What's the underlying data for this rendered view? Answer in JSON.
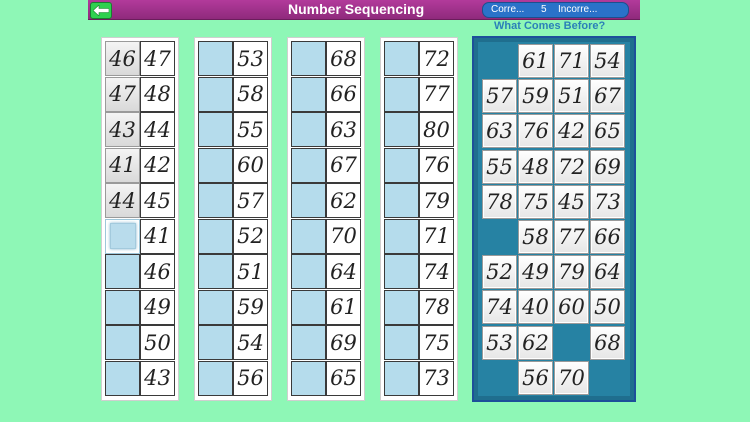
{
  "header": {
    "title": "Number Sequencing",
    "correct_label": "Corre...",
    "correct_count": "5",
    "incorrect_label": "Incorre...",
    "subtitle": "What Comes Before?",
    "back_icon": "back-arrow-icon"
  },
  "columns": [
    {
      "pairs": [
        [
          "46",
          "47"
        ],
        [
          "47",
          "48"
        ],
        [
          "43",
          "44"
        ],
        [
          "41",
          "42"
        ],
        [
          "44",
          "45"
        ],
        [
          "",
          "41"
        ],
        [
          "",
          "46"
        ],
        [
          "",
          "49"
        ],
        [
          "",
          "50"
        ],
        [
          "",
          "43"
        ]
      ],
      "selected_row": 5
    },
    {
      "pairs": [
        [
          "",
          "53"
        ],
        [
          "",
          "58"
        ],
        [
          "",
          "55"
        ],
        [
          "",
          "60"
        ],
        [
          "",
          "57"
        ],
        [
          "",
          "52"
        ],
        [
          "",
          "51"
        ],
        [
          "",
          "59"
        ],
        [
          "",
          "54"
        ],
        [
          "",
          "56"
        ]
      ],
      "selected_row": -1
    },
    {
      "pairs": [
        [
          "",
          "68"
        ],
        [
          "",
          "66"
        ],
        [
          "",
          "63"
        ],
        [
          "",
          "67"
        ],
        [
          "",
          "62"
        ],
        [
          "",
          "70"
        ],
        [
          "",
          "64"
        ],
        [
          "",
          "61"
        ],
        [
          "",
          "69"
        ],
        [
          "",
          "65"
        ]
      ],
      "selected_row": -1
    },
    {
      "pairs": [
        [
          "",
          "72"
        ],
        [
          "",
          "77"
        ],
        [
          "",
          "80"
        ],
        [
          "",
          "76"
        ],
        [
          "",
          "79"
        ],
        [
          "",
          "71"
        ],
        [
          "",
          "74"
        ],
        [
          "",
          "78"
        ],
        [
          "",
          "75"
        ],
        [
          "",
          "73"
        ]
      ],
      "selected_row": -1
    }
  ],
  "tray": {
    "rows": [
      [
        "",
        "61",
        "71",
        "54"
      ],
      [
        "57",
        "59",
        "51",
        "67"
      ],
      [
        "63",
        "76",
        "42",
        "65"
      ],
      [
        "55",
        "48",
        "72",
        "69"
      ],
      [
        "78",
        "75",
        "45",
        "73"
      ],
      [
        "",
        "58",
        "77",
        "66"
      ],
      [
        "52",
        "49",
        "79",
        "64"
      ],
      [
        "74",
        "40",
        "60",
        "50"
      ],
      [
        "53",
        "62",
        "",
        "68"
      ],
      [
        "",
        "56",
        "70",
        ""
      ]
    ]
  },
  "colors": {
    "background": "#8ef7b6",
    "header_bar": "#a0348b",
    "score_pill": "#2a72c9",
    "slot_blue": "#b5dcec",
    "tray_blue": "#2682a3"
  }
}
